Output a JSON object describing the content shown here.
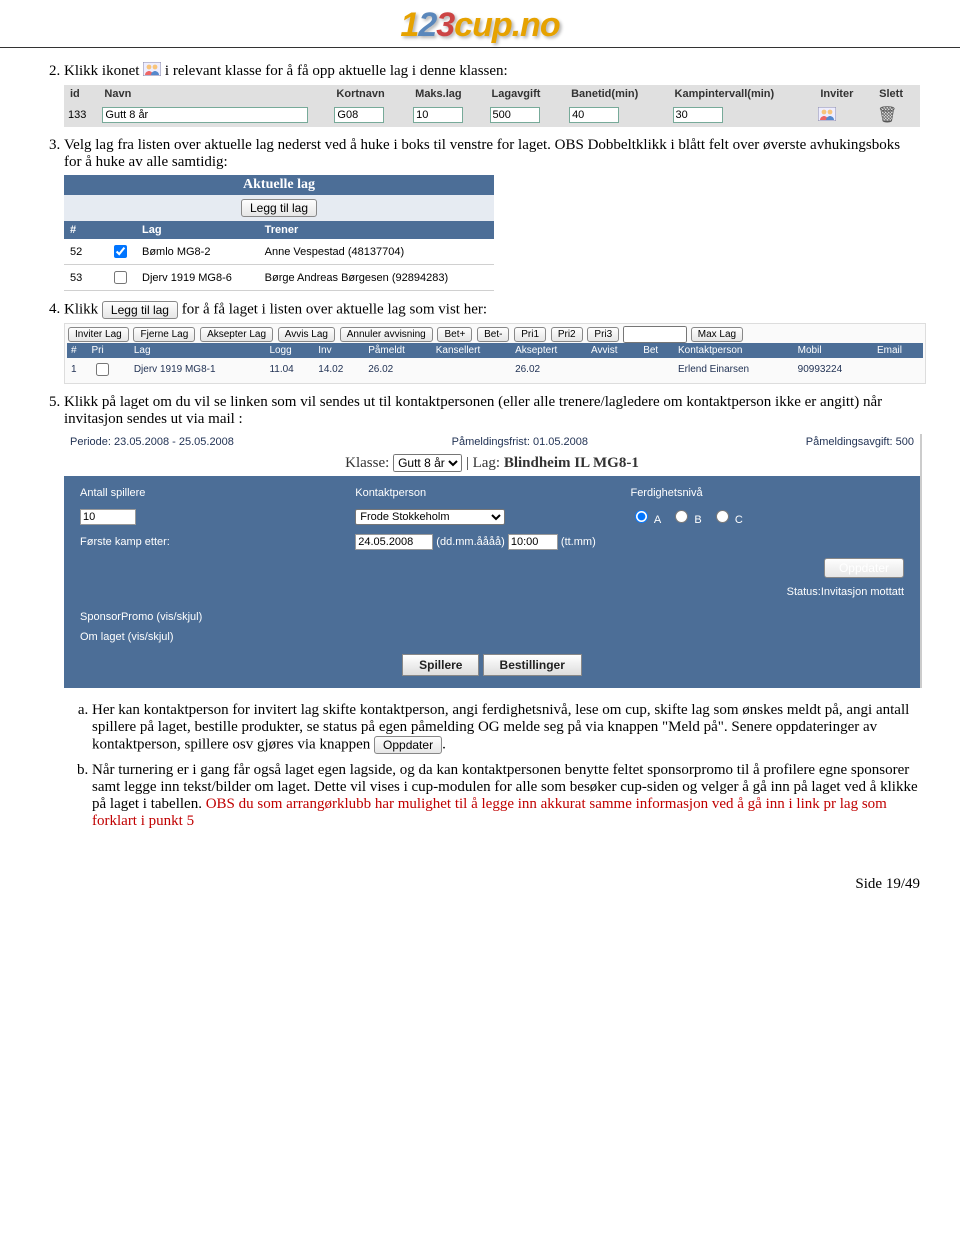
{
  "logo": {
    "text": "123cup.no"
  },
  "step2": {
    "pre": "Klikk ikonet",
    "post": " i relevant klasse for å få opp aktuelle lag i denne klassen:"
  },
  "classTable": {
    "headers": [
      "id",
      "Navn",
      "Kortnavn",
      "Maks.lag",
      "Lagavgift",
      "Banetid(min)",
      "Kampintervall(min)",
      "Inviter",
      "Slett"
    ],
    "row": {
      "id": "133",
      "navn": "Gutt 8 år",
      "kort": "G08",
      "maks": "10",
      "avgift": "500",
      "banetid": "40",
      "intervall": "30"
    }
  },
  "step3": "Velg lag fra listen over aktuelle lag nederst ved å huke i boks til venstre for laget. OBS Dobbeltklikk i blått felt over øverste avhukingsboks for å huke av alle samtidig:",
  "aktuelle": {
    "title": "Aktuelle lag",
    "add": "Legg til lag",
    "headers": [
      "#",
      "Lag",
      "Trener"
    ],
    "rows": [
      {
        "n": "52",
        "checked": true,
        "lag": "Bømlo MG8-2",
        "trener": "Anne Vespestad (48137704)"
      },
      {
        "n": "53",
        "checked": false,
        "lag": "Djerv 1919 MG8-6",
        "trener": "Børge Andreas Børgesen (92894283)"
      }
    ]
  },
  "step4": {
    "pre": "Klikk ",
    "btn": "Legg til lag",
    "post": " for å få laget i listen over aktuelle lag som vist her:"
  },
  "actions": {
    "btns": [
      "Inviter Lag",
      "Fjerne Lag",
      "Aksepter Lag",
      "Avvis Lag",
      "Annuler avvisning",
      "Bet+",
      "Bet-",
      "Pri1",
      "Pri2",
      "Pri3"
    ],
    "maxlag": "Max Lag",
    "headers": [
      "#",
      "Pri",
      "Lag",
      "Logg",
      "Inv",
      "Påmeldt",
      "Kansellert",
      "Akseptert",
      "Avvist",
      "Bet",
      "Kontaktperson",
      "Mobil",
      "Email"
    ],
    "row": {
      "n": "1",
      "pri": "",
      "lag": "Djerv 1919 MG8-1",
      "logg": "11.04",
      "inv": "14.02",
      "pameldt": "26.02",
      "kans": "",
      "aks": "26.02",
      "avv": "",
      "bet": "",
      "kontakt": "Erlend Einarsen",
      "mobil": "90993224",
      "email": ""
    }
  },
  "step5": "Klikk på laget om du vil se linken som vil sendes ut til kontaktpersonen (eller alle trenere/lagledere om kontaktperson ikke er angitt) når invitasjon sendes ut via mail :",
  "form": {
    "periode": "Periode: 23.05.2008 - 25.05.2008",
    "frist": "Påmeldingsfrist: 01.05.2008",
    "avgift": "Påmeldingsavgift: 500",
    "klasseLabel": "Klasse:",
    "klasseVal": "Gutt 8 år",
    "lagLabel": "| Lag:",
    "lagVal": "Blindheim IL MG8-1",
    "antall_lbl": "Antall spillere",
    "antall": "10",
    "kontakt_lbl": "Kontaktperson",
    "kontakt": "Frode Stokkeholm",
    "ferdig_lbl": "Ferdighetsnivå",
    "ferdigA": "A",
    "ferdigB": "B",
    "ferdigC": "C",
    "forste_lbl": "Første kamp etter:",
    "forste_date": "24.05.2008",
    "forste_date_hint": "(dd.mm.åååå)",
    "forste_time": "10:00",
    "forste_time_hint": "(tt.mm)",
    "oppdater": "Oppdater",
    "status": "Status:Invitasjon mottatt",
    "sponsor": "SponsorPromo (vis/skjul)",
    "omlaget": "Om laget (vis/skjul)",
    "tab1": "Spillere",
    "tab2": "Bestillinger"
  },
  "subA": {
    "t1": "Her kan kontaktperson for invitert lag skifte kontaktperson, angi ferdighetsnivå, lese om cup, skifte lag som ønskes meldt på, angi antall spillere på laget, bestille produkter, se status på egen påmelding OG melde seg på via knappen \"Meld på\". Senere oppdateringer av kontaktperson, spillere osv gjøres via knappen ",
    "btn": "Oppdater",
    "t2": "."
  },
  "subB": {
    "t1": "Når turnering er i gang får også laget egen lagside, og da kan kontaktpersonen benytte feltet sponsorpromo til å profilere egne sponsorer samt legge inn tekst/bilder om laget. Dette vil vises i cup-modulen for alle som besøker cup-siden og velger å gå inn på laget ved å klikke på laget i tabellen. ",
    "t2": "OBS du som arrangørklubb har mulighet til å legge inn akkurat samme informasjon ved å gå inn i link pr lag som forklart i punkt 5"
  },
  "footer": "Side 19/49"
}
